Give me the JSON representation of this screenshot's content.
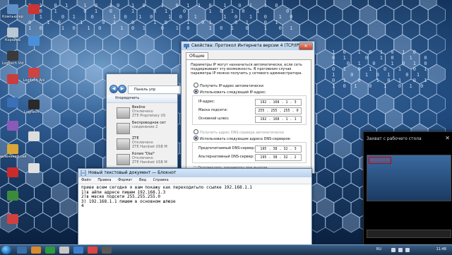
{
  "desktop_icons": [
    {
      "label": "Компьютер",
      "color": "#5f8fc4"
    },
    {
      "label": "Корзина",
      "color": "#b9c6d4"
    },
    {
      "label": "Logitech Vid",
      "color": "#3a3a3a"
    },
    {
      "label": "",
      "color": "#c93d3d"
    },
    {
      "label": "",
      "color": "#3b6fb6"
    },
    {
      "label": "",
      "color": "#8a5ab8"
    },
    {
      "label": "маленький сайт",
      "color": "#d9a63a"
    },
    {
      "label": "",
      "color": "#cc2b2b"
    },
    {
      "label": "",
      "color": "#3c8a3c"
    },
    {
      "label": "",
      "color": "#d04040"
    }
  ],
  "desktop_icons_col2": [
    {
      "label": "",
      "color": "#cc3333"
    },
    {
      "label": "",
      "color": "#4a90d9"
    },
    {
      "label": "Logitech Ani",
      "color": "#c44"
    },
    {
      "label": "Logitech ...",
      "color": "#2a2a2a"
    },
    {
      "label": "",
      "color": "#dcdcdc"
    },
    {
      "label": "",
      "color": "#e0e0e0"
    }
  ],
  "network_window": {
    "address": "Панель упр",
    "toolbar_label": "Упорядочить",
    "connections": [
      {
        "name": "Beeline",
        "status": "Отключено",
        "device": "ZTE Proprietary US"
      },
      {
        "name": "Беспроводное сет",
        "status": "соединение 2",
        "device": ""
      },
      {
        "name": "ZTE",
        "status": "Отключено",
        "device": "ZTE Handset USB M"
      },
      {
        "name": "Копия \"Dial\"",
        "status": "Отключено",
        "device": "ZTE Handset USB M"
      }
    ]
  },
  "ipv4_dialog": {
    "title": "Свойства: Протокол Интернета версии 4 (TCP/IPv4)",
    "tab": "Общие",
    "description": "Параметры IP могут назначаться автоматически, если сеть поддерживает эту возможность. В противном случае параметры IP можно получить у сетевого администратора.",
    "radio_auto_ip": "Получить IP-адрес автоматически",
    "radio_manual_ip": "Использовать следующий IP-адрес:",
    "ip_label": "IP-адрес:",
    "ip_value": "192 . 168 .  1  .  3",
    "mask_label": "Маска подсети:",
    "mask_value": "255 . 255 . 255 .  0",
    "gateway_label": "Основной шлюз:",
    "gateway_value": "192 . 168 .  1  .  1",
    "radio_auto_dns": "Получить адрес DNS-сервера автоматически",
    "radio_manual_dns": "Использовать следующие адреса DNS-серверов:",
    "dns1_label": "Предпочитаемый DNS-сервер:",
    "dns1_value": "195 . 38 .  32  .  3",
    "dns2_label": "Альтернативный DNS-сервер:",
    "dns2_value": "195 . 38 .  32  .  2",
    "checkbox_label": "Подтвердить параметры при выходе"
  },
  "notepad": {
    "title": "Новый текстовый документ — Блокнот",
    "menu": [
      "Файл",
      "Правка",
      "Формат",
      "Вид",
      "Справка"
    ],
    "content": "приве всем сегодня я вам покажу как переходитьпо ссылке 192.168.1.1\n1)в айпи адресе пишем 192.168.1.3\n2)в маске подсети 255.255.255.0\n3) 192.168.1.1 пишем в основном шлюзе\n4"
  },
  "capture_window": {
    "title": "Захват с рабочего стола",
    "rec_label": "REC 00:03:51"
  },
  "taskbar": {
    "clock": "11:48",
    "lang": "RU"
  }
}
